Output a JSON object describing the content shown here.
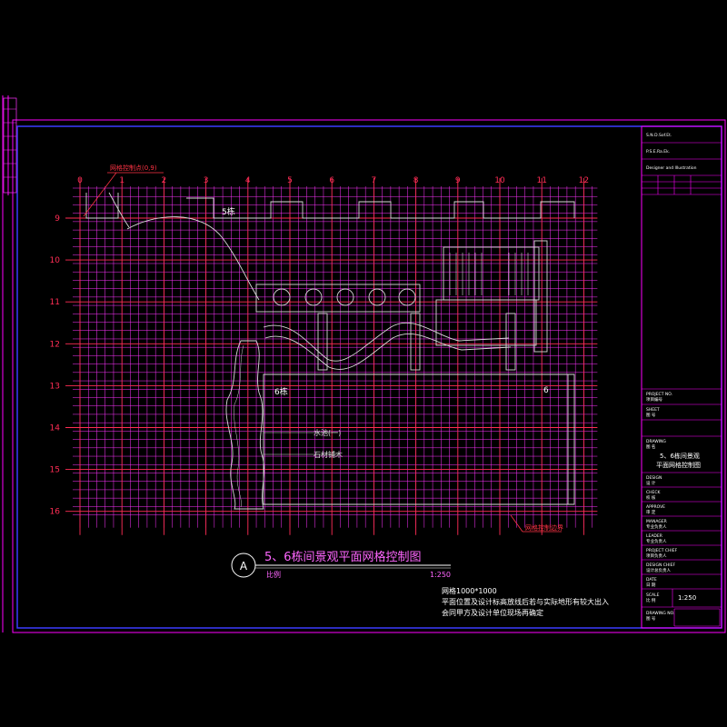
{
  "colors": {
    "background": "#000000",
    "frame": "#ff00ff",
    "inner_frame": "#3a3aff",
    "grid_major": "#ff2d55",
    "grid_minor": "#ff33ff",
    "plan": "#d8d8d8",
    "title_text": "#ff66ff",
    "text_white": "#ffffff",
    "text_red": "#ff3344"
  },
  "grid": {
    "col_labels": [
      "0",
      "1",
      "2",
      "3",
      "4",
      "5",
      "6",
      "7",
      "8",
      "9",
      "10",
      "11",
      "12"
    ],
    "row_labels": [
      "9",
      "10",
      "11",
      "12",
      "13",
      "14",
      "15",
      "16"
    ]
  },
  "plan_labels": {
    "building_5": "5栋",
    "building_6": "6栋",
    "side_6": "6",
    "grid_origin_note": "网格控制点(0,9)",
    "boundary_note": "网格控制边界",
    "water_1": "水池(一)",
    "water_2": "石材铺木"
  },
  "drawing_title": {
    "marker": "A",
    "title": "5、6栋间景观平面网格控制图",
    "scale_label": "比例",
    "scale_value": "1:250"
  },
  "notes": {
    "line1": "网格1000*1000",
    "line2": "平面位置及设计标高放线后若与实际地形有较大出入",
    "line3": "会同甲方及设计单位现场再确定"
  },
  "title_block": {
    "header_1": "S.N.D.Sof.Et.",
    "header_2": "P.S.E.Ra.Ek.",
    "header_3": "Designer and Illustration",
    "project_en": "PROJECT NO.",
    "project_cn": "项目编号",
    "sheet_en": "SHEET",
    "sheet_cn": "图 号",
    "drawing_en": "DRAWING",
    "drawing_cn": "图 名",
    "drawing_name_1": "5、6栋间景观",
    "drawing_name_2": "平面网格控制图",
    "design_en": "DESIGN",
    "design_cn": "设 计",
    "check_en": "CHECK",
    "check_cn": "校 核",
    "approve_en": "APPROVE",
    "approve_cn": "审 定",
    "manager_en": "MANAGER",
    "manager_cn": "专业负责人",
    "leader_en": "LEADER",
    "leader_cn": "专业负责人",
    "chief_en": "PROJECT CHIEF",
    "chief_cn": "项目负责人",
    "director_en": "DESIGN CHIEF",
    "director_cn": "设计总负责人",
    "date_en": "DATE",
    "date_cn": "日 期",
    "scale_en": "SCALE",
    "scale_cn": "比 例",
    "scale_value": "1:250",
    "drawing_no_en": "DRAWING NO.",
    "drawing_no_cn": "图 号"
  }
}
